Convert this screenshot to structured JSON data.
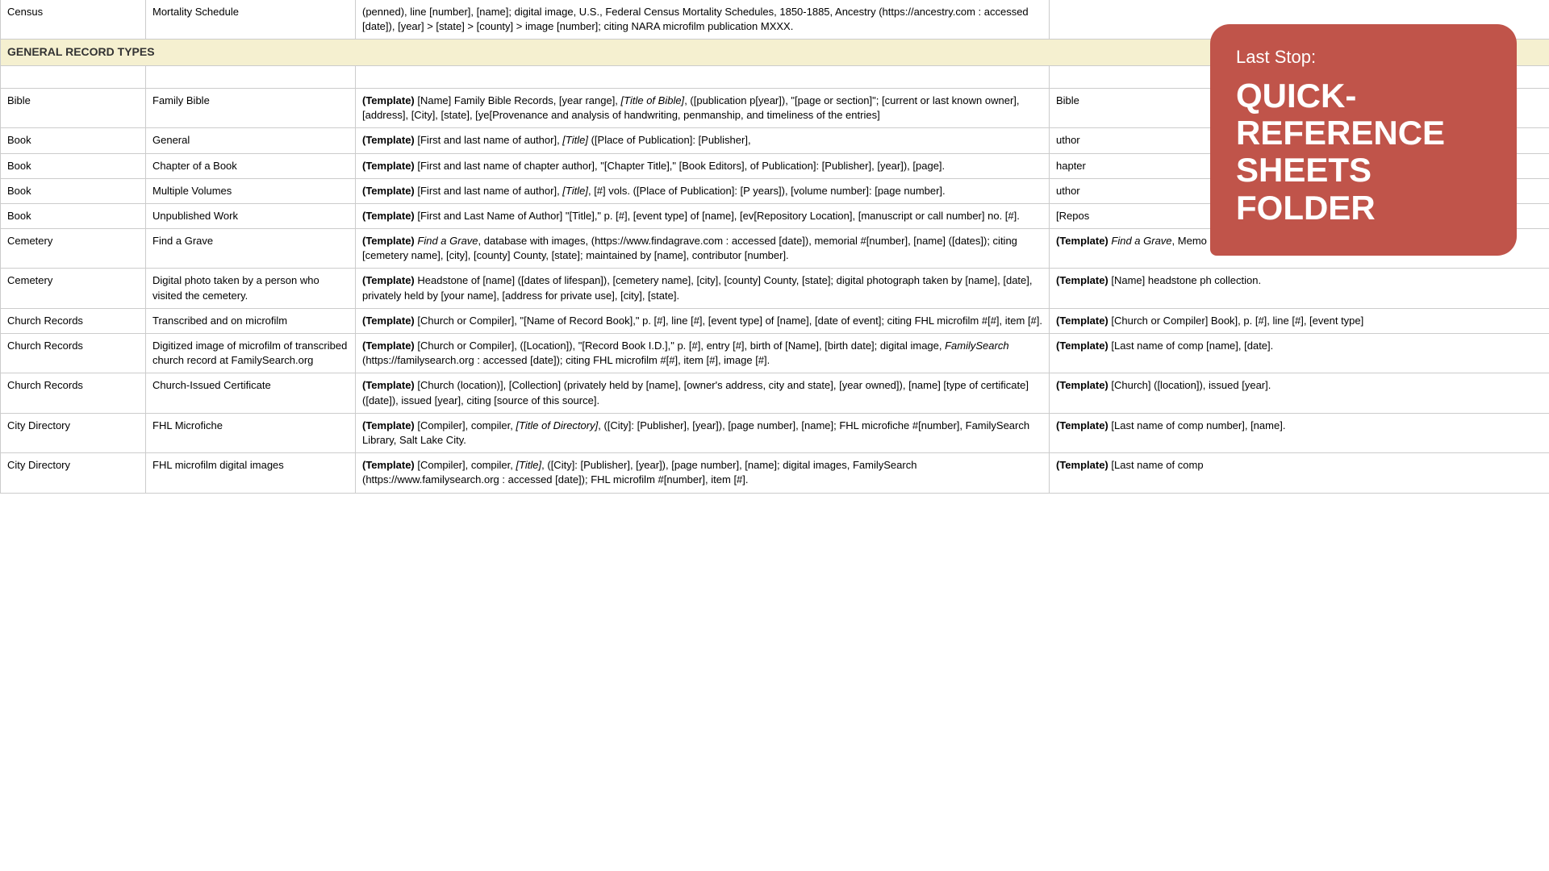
{
  "overlay": {
    "last_stop_label": "Last Stop:",
    "main_title": "QUICK-REFERENCE\nSHEETS FOLDER"
  },
  "table": {
    "top_rows": [
      {
        "col1": "Census",
        "col2": "Mortality Schedule",
        "col3": "(penned), line [number], [name]; digital image, U.S., Federal Census Mortality Schedules, 1850-1885, Ancestry (https://ancestry.com : accessed [date]), [year] > [state] > [county] > image [number]; citing NARA microfilm publication MXXX.",
        "col4": ""
      }
    ],
    "section_header": "GENERAL RECORD TYPES",
    "rows": [
      {
        "col1": "",
        "col2": "",
        "col3": "",
        "col4": "",
        "empty": true
      },
      {
        "col1": "Bible",
        "col2": "Family Bible",
        "col3_template": "Template",
        "col3_rest": " [Name] Family Bible Records, [year range], [Title of Bible], ([publication p[year]), \"[page or section]\"; [current or last known owner], [address], [City], [state], [ye[Provenance and analysis of handwriting, penmanship, and timeliness of the entries]",
        "col4_template": "",
        "col4_rest": "Bible"
      },
      {
        "col1": "Book",
        "col2": "General",
        "col3_template": "Template",
        "col3_rest": " [First and last name of author], [Title] ([Place of Publication]: [Publisher],",
        "col4_template": "",
        "col4_rest": "uthor"
      },
      {
        "col1": "Book",
        "col2": "Chapter of a Book",
        "col3_template": "Template",
        "col3_rest": " [First and last name of chapter author], \"[Chapter Title],\" [Book Editors], of Publication]: [Publisher], [year]), [page].",
        "col4_template": "",
        "col4_rest": "hapter"
      },
      {
        "col1": "Book",
        "col2": "Multiple Volumes",
        "col3_template": "Template",
        "col3_rest": " [First and last name of author], [Title], [#] vols. ([Place of Publication]: [P years]), [volume number]: [page number].",
        "col4_template": "",
        "col4_rest": "uthor"
      },
      {
        "col1": "Book",
        "col2": "Unpublished Work",
        "col3_template": "Template",
        "col3_rest": " [First and Last Name of Author] \"[Title],\" p. [#], [event type] of [name], [ev[Repository Location], [manuscript or call number] no. [#].",
        "col4_template": "",
        "col4_rest": "[Repos"
      },
      {
        "col1": "Cemetery",
        "col2": "Find a Grave",
        "col3_template": "Template",
        "col3_italic": "Find a Grave",
        "col3_rest": ", database with images, (https://www.findagrave.com : accessed [date]), memorial #[number], [name] ([dates]); citing [cemetery name], [city], [county] County, [state]; maintained by [name], contributor [number].",
        "col4_template": "Template",
        "col4_italic": "Find a Grave",
        "col4_rest": ", Memo"
      },
      {
        "col1": "Cemetery",
        "col2": "Digital photo taken by a person who visited the cemetery.",
        "col3_template": "Template",
        "col3_rest": " Headstone of [name] ([dates of lifespan]), [cemetery name], [city], [county] County, [state]; digital photograph taken by [name], [date], privately held by [your name], [address for private use], [city], [state].",
        "col4_template": "Template",
        "col4_rest": " [Name] headstone ph collection."
      },
      {
        "col1": "Church Records",
        "col2": "Transcribed and on microfilm",
        "col3_template": "Template",
        "col3_rest": " [Church or Compiler], \"[Name of Record Book],\" p. [#], line [#], [event type] of [name], [date of event]; citing FHL microfilm #[#], item [#].",
        "col4_template": "Template",
        "col4_rest": " [Church or Compiler] Book], p. [#], line [#], [event type]"
      },
      {
        "col1": "Church Records",
        "col2": "Digitized image of microfilm of transcribed church record at FamilySearch.org",
        "col3_template": "Template",
        "col3_rest": " [Church or Compiler], ([Location]), \"[Record Book I.D.],\" p. [#], entry [#], birth of [Name], [birth date]; digital image, FamilySearch (https://familysearch.org : accessed [date]); citing FHL microfilm #[#], item [#], image [#].",
        "col4_template": "Template",
        "col4_rest": " [Last name of comp [name], [date]."
      },
      {
        "col1": "Church Records",
        "col2": "Church-Issued Certificate",
        "col3_template": "Template",
        "col3_rest": " [Church (location)], [Collection] (privately held by [name], [owner's address, city and state], [year owned]), [name] [type of certificate] ([date]), issued [year], citing [source of this source].",
        "col4_template": "Template",
        "col4_rest": " [Church] ([location]), issued [year]."
      },
      {
        "col1": "City Directory",
        "col2": "FHL Microfiche",
        "col3_template": "Template",
        "col3_rest": " [Compiler], compiler, [Title of Directory], ([City]: [Publisher], [year]), [page number], [name]; FHL microfiche #[number], FamilySearch Library, Salt Lake City.",
        "col4_template": "Template",
        "col4_rest": " [Last name of comp number], [name]."
      },
      {
        "col1": "City Directory",
        "col2": "FHL microfilm digital images",
        "col3_template": "Template",
        "col3_italic_title": "Title",
        "col3_rest": " [Compiler], compiler, [Title], ([City]: [Publisher], [year]), [page number], [name]; digital images, FamilySearch (https://www.familysearch.org : accessed [date]); FHL microfilm #[number], item [#].",
        "col4_template": "Template",
        "col4_rest": " [Last name of comp"
      }
    ]
  }
}
